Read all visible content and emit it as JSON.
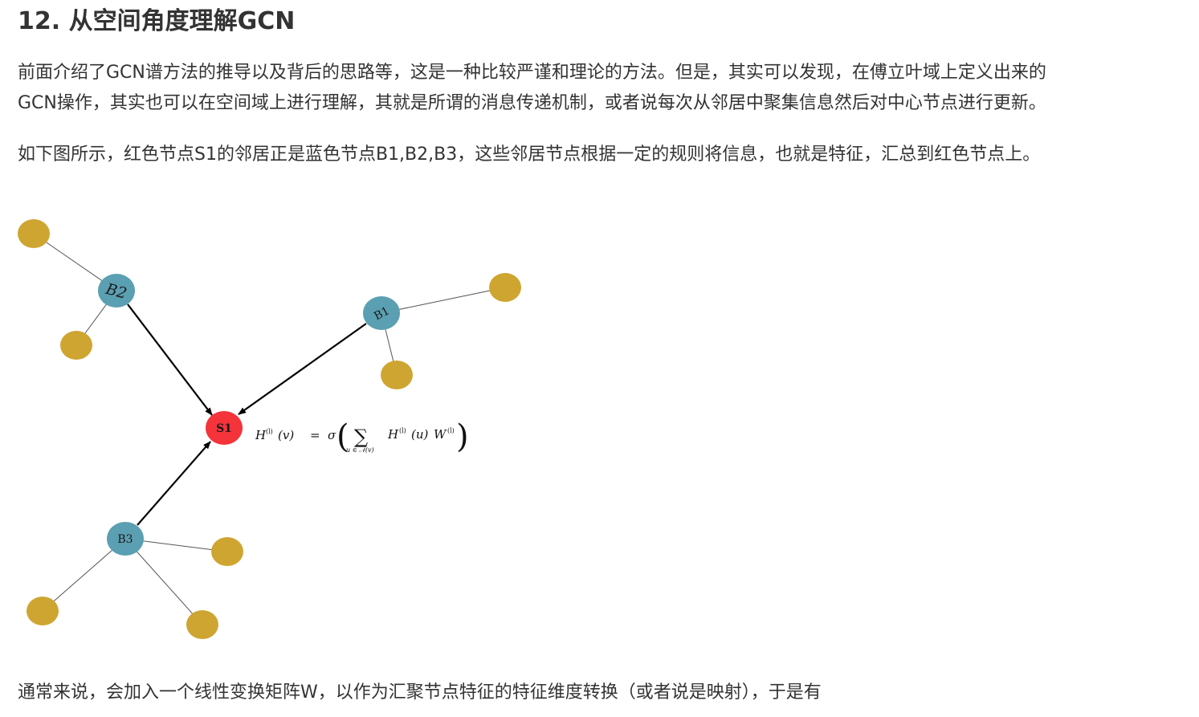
{
  "title": "12. 从空间角度理解GCN",
  "paragraphs": {
    "p1_line1": "前面介绍了GCN谱方法的推导以及背后的思路等，这是一种比较严谨和理论的方法。但是，其实可以发现，在傅立叶域上定义出来的",
    "p1_line2": "GCN操作，其实也可以在空间域上进行理解，其就是所谓的消息传递机制，或者说每次从邻居中聚集信息然后对中心节点进行更新。",
    "p2": "如下图所示，红色节点S1的邻居正是蓝色节点B1,B2,B3，这些邻居节点根据一定的规则将信息，也就是特征，汇总到红色节点上。",
    "p3": "通常来说，会加入一个线性变换矩阵W，以作为汇聚节点特征的特征维度转换（或者说是映射），于是有"
  },
  "diagram": {
    "nodes": {
      "s1": "S1",
      "b1": "B1",
      "b2": "B2",
      "b3": "B3"
    },
    "colors": {
      "center": "#f4333a",
      "neighbor": "#5b9fb2",
      "leaf": "#cfa532",
      "edge": "#000000",
      "thin_edge": "#555555"
    },
    "formula": {
      "lhs_H": "H",
      "sup_l": "(l)",
      "lhs_arg": "(v)",
      "equals": "=",
      "sigma": "σ",
      "lparen": "(",
      "sum": "∑",
      "sum_index": "u ∈ 𝒩(v)",
      "rhs_H": "H",
      "rhs_arg": "(u)",
      "W": "W",
      "rparen": ")"
    }
  }
}
